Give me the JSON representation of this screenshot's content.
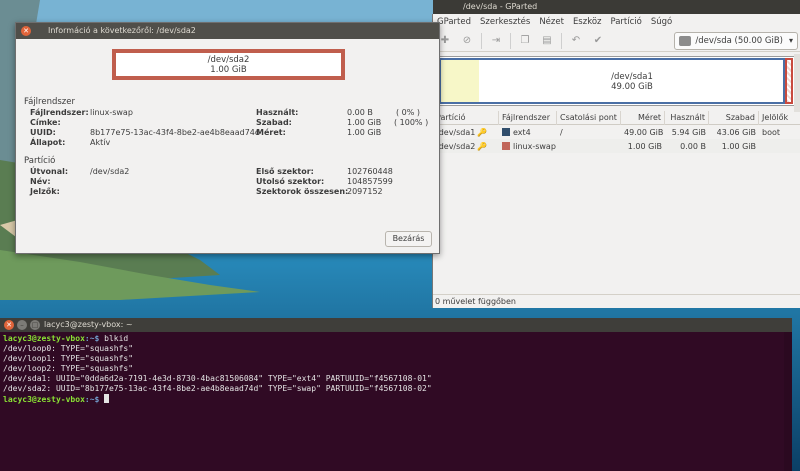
{
  "gparted": {
    "title": "/dev/sda - GParted",
    "menu": [
      "GParted",
      "Szerkesztés",
      "Nézet",
      "Eszköz",
      "Partíció",
      "Súgó"
    ],
    "device": "/dev/sda  (50.00 GiB)",
    "map": {
      "sda1_name": "/dev/sda1",
      "sda1_size": "49.00 GiB"
    },
    "columns": [
      "Partíció",
      "Fájlrendszer",
      "Csatolási pont",
      "Méret",
      "Használt",
      "Szabad",
      "Jelölők"
    ],
    "rows": [
      {
        "partition": "/dev/sda1",
        "fs": "ext4",
        "fs_color": "#314e6c",
        "mount": "/",
        "size": "49.00 GiB",
        "used": "5.94 GiB",
        "free": "43.06 GiB",
        "flags": "boot"
      },
      {
        "partition": "/dev/sda2",
        "fs": "linux-swap",
        "fs_color": "#c1665a",
        "mount": "",
        "size": "1.00 GiB",
        "used": "0.00 B",
        "free": "1.00 GiB",
        "flags": ""
      }
    ],
    "status": "0 művelet függőben"
  },
  "info": {
    "title": "Információ a következőről: /dev/sda2",
    "map_name": "/dev/sda2",
    "map_size": "1.00 GiB",
    "fs_section": "Fájlrendszer",
    "fs_label": "Fájlrendszer:",
    "fs_value": "linux-swap",
    "cimke_label": "Címke:",
    "uuid_label": "UUID:",
    "uuid_value": "8b177e75-13ac-43f4-8be2-ae4b8eaad74d",
    "allapot_label": "Állapot:",
    "allapot_value": "Aktív",
    "hasznalt_label": "Használt:",
    "hasznalt_value": "0.00 B",
    "hasznalt_pct": "( 0% )",
    "szabad_label": "Szabad:",
    "szabad_value": "1.00 GiB",
    "szabad_pct": "( 100% )",
    "meret_label": "Méret:",
    "meret_value": "1.00 GiB",
    "part_section": "Partíció",
    "utvonal_label": "Útvonal:",
    "utvonal_value": "/dev/sda2",
    "nev_label": "Név:",
    "jelzok_label": "Jelzők:",
    "elso_label": "Első szektor:",
    "elso_value": "102760448",
    "utolso_label": "Utolsó szektor:",
    "utolso_value": "104857599",
    "osszes_label": "Szektorok összesen:",
    "osszes_value": "2097152",
    "close_label": "Bezárás"
  },
  "terminal": {
    "title": "lacyc3@zesty-vbox: ~",
    "prompt_user": "lacyc3@zesty-vbox",
    "prompt_path": ":~$",
    "command": " blkid",
    "lines": [
      "/dev/loop0: TYPE=\"squashfs\"",
      "/dev/loop1: TYPE=\"squashfs\"",
      "/dev/loop2: TYPE=\"squashfs\"",
      "/dev/sda1: UUID=\"0dda6d2a-7191-4e3d-8730-4bac81506084\" TYPE=\"ext4\" PARTUUID=\"f4567108-01\"",
      "/dev/sda2: UUID=\"8b177e75-13ac-43f4-8be2-ae4b8eaad74d\" TYPE=\"swap\" PARTUUID=\"f4567108-02\""
    ]
  }
}
